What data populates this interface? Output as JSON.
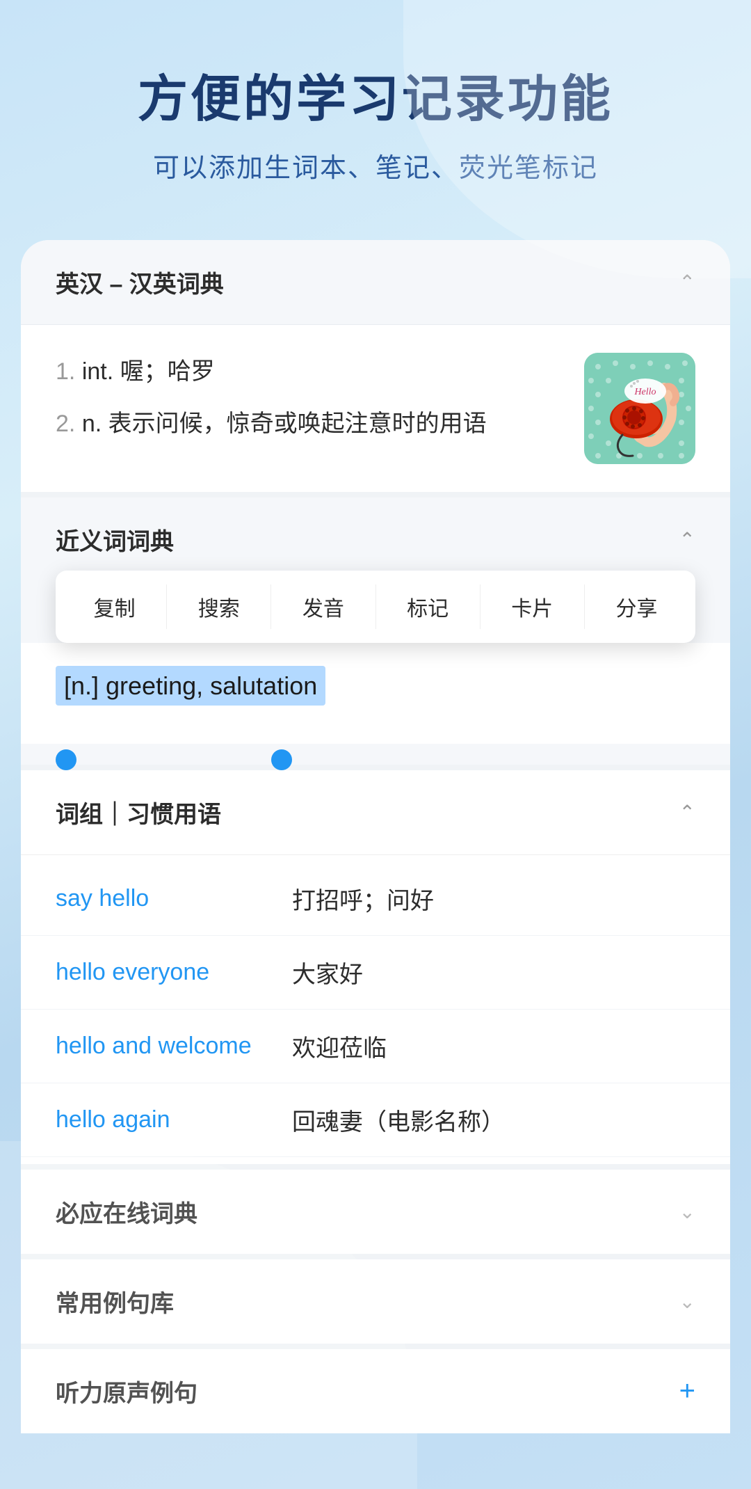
{
  "header": {
    "title": "方便的学习记录功能",
    "subtitle": "可以添加生词本、笔记、荧光笔标记"
  },
  "dictionary_section": {
    "title": "英汉 – 汉英词典",
    "definitions": [
      {
        "num": "1.",
        "pos": "int.",
        "text": "喔；哈罗"
      },
      {
        "num": "2.",
        "pos": "n.",
        "text": "表示问候，惊奇或唤起注意时的用语"
      }
    ]
  },
  "synonyms_section": {
    "title": "近义词词典",
    "context_menu": [
      "复制",
      "搜索",
      "发音",
      "标记",
      "卡片",
      "分享"
    ],
    "synonym_text": "[n.] greeting, salutation"
  },
  "phrases_section": {
    "title": "词组｜习惯用语",
    "phrases": [
      {
        "en": "say hello",
        "zh": "打招呼；问好"
      },
      {
        "en": "hello everyone",
        "zh": "大家好"
      },
      {
        "en": "hello and welcome",
        "zh": "欢迎莅临"
      },
      {
        "en": "hello again",
        "zh": "回魂妻（电影名称）"
      }
    ]
  },
  "bottom_sections": [
    {
      "title": "必应在线词典",
      "icon": "chevron-down"
    },
    {
      "title": "常用例句库",
      "icon": "chevron-down"
    },
    {
      "title": "听力原声例句",
      "icon": "plus"
    }
  ]
}
